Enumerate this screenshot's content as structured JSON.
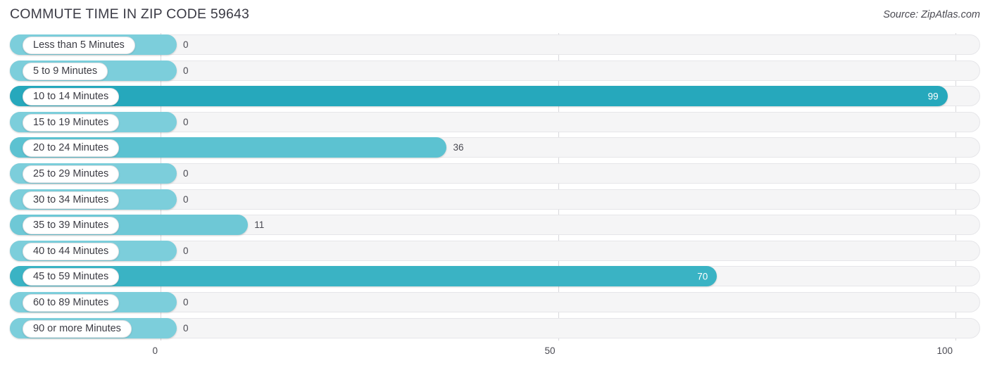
{
  "header": {
    "title": "COMMUTE TIME IN ZIP CODE 59643",
    "source": "Source: ZipAtlas.com"
  },
  "colors": {
    "bar_strong": "#26a8bc",
    "bar_medium": "#55c0d0",
    "bar_zero": "#7ccedb",
    "track_bg": "#f5f5f6",
    "track_border": "#e6e6e9",
    "gridline": "#d8d8dc",
    "text": "#3c3c44",
    "value_inside": "#ffffff"
  },
  "chart_data": {
    "type": "bar",
    "orientation": "horizontal",
    "title": "COMMUTE TIME IN ZIP CODE 59643",
    "xlabel": "",
    "ylabel": "",
    "xlim": [
      0,
      100
    ],
    "grid": true,
    "gridline_positions": [
      0,
      50,
      100
    ],
    "xticks": [
      "0",
      "50",
      "100"
    ],
    "xtick_values": [
      0,
      50,
      100
    ],
    "legend": null,
    "categories": [
      "Less than 5 Minutes",
      "5 to 9 Minutes",
      "10 to 14 Minutes",
      "15 to 19 Minutes",
      "20 to 24 Minutes",
      "25 to 29 Minutes",
      "30 to 34 Minutes",
      "35 to 39 Minutes",
      "40 to 44 Minutes",
      "45 to 59 Minutes",
      "60 to 89 Minutes",
      "90 or more Minutes"
    ],
    "values": [
      0,
      0,
      99,
      0,
      36,
      0,
      0,
      11,
      0,
      70,
      0,
      0
    ],
    "value_labels": [
      "0",
      "0",
      "99",
      "0",
      "36",
      "0",
      "0",
      "11",
      "0",
      "70",
      "0",
      "0"
    ]
  },
  "rows": [
    {
      "label": "Less than 5 Minutes",
      "value": 0,
      "value_label": "0",
      "inside": false,
      "color": "#7ccedb"
    },
    {
      "label": "5 to 9 Minutes",
      "value": 0,
      "value_label": "0",
      "inside": false,
      "color": "#7ccedb"
    },
    {
      "label": "10 to 14 Minutes",
      "value": 99,
      "value_label": "99",
      "inside": true,
      "color": "#26a8bc"
    },
    {
      "label": "15 to 19 Minutes",
      "value": 0,
      "value_label": "0",
      "inside": false,
      "color": "#7ccedb"
    },
    {
      "label": "20 to 24 Minutes",
      "value": 36,
      "value_label": "36",
      "inside": false,
      "color": "#5cc2d1"
    },
    {
      "label": "25 to 29 Minutes",
      "value": 0,
      "value_label": "0",
      "inside": false,
      "color": "#7ccedb"
    },
    {
      "label": "30 to 34 Minutes",
      "value": 0,
      "value_label": "0",
      "inside": false,
      "color": "#7ccedb"
    },
    {
      "label": "35 to 39 Minutes",
      "value": 11,
      "value_label": "11",
      "inside": false,
      "color": "#6ec8d6"
    },
    {
      "label": "40 to 44 Minutes",
      "value": 0,
      "value_label": "0",
      "inside": false,
      "color": "#7ccedb"
    },
    {
      "label": "45 to 59 Minutes",
      "value": 70,
      "value_label": "70",
      "inside": true,
      "color": "#3ab3c4"
    },
    {
      "label": "60 to 89 Minutes",
      "value": 0,
      "value_label": "0",
      "inside": false,
      "color": "#7ccedb"
    },
    {
      "label": "90 or more Minutes",
      "value": 0,
      "value_label": "0",
      "inside": false,
      "color": "#7ccedb"
    }
  ],
  "axis": {
    "ticks": [
      {
        "label": "0",
        "value": 0
      },
      {
        "label": "50",
        "value": 50
      },
      {
        "label": "100",
        "value": 100
      }
    ]
  }
}
